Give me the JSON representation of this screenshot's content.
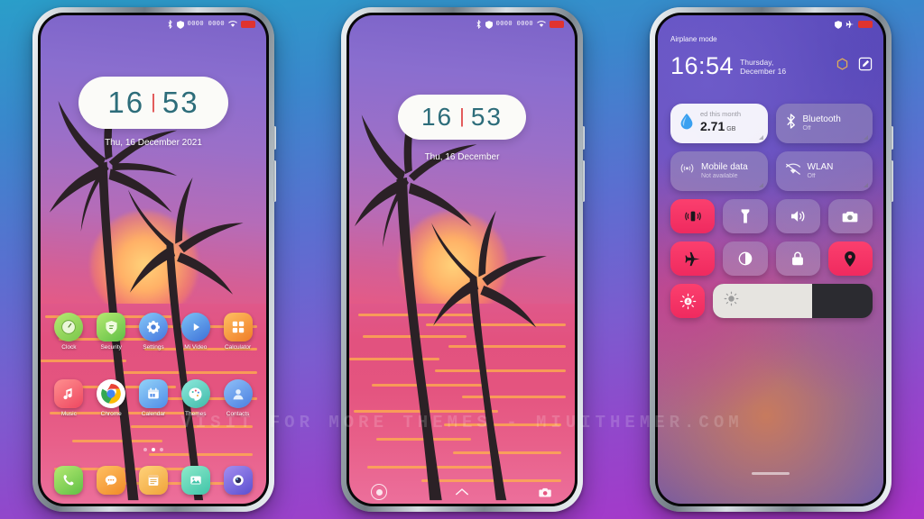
{
  "background": {
    "top_color": "#2a9ec9",
    "bottom_color": "#ab34c9"
  },
  "watermark": {
    "text": "VISIT FOR MORE THEMES - MIUITHEMER.COM"
  },
  "phone1": {
    "label": "lock-and-home-screen",
    "status_bar": {
      "bluetooth": "bluetooth-icon",
      "shield": "shield-icon",
      "signal": "0000 0000",
      "wifi": "wifi-icon",
      "battery": "battery-icon",
      "battery_color": "#e0332f"
    },
    "clock": {
      "hours": "16",
      "separator": "|",
      "minutes": "53"
    },
    "date": "Thu, 16 December 2021",
    "apps_row1": [
      {
        "label": "Clock",
        "icon": "clock-icon",
        "color1": "#a8e063",
        "color2": "#7ec850",
        "round": true
      },
      {
        "label": "Security",
        "icon": "shield-icon",
        "color1": "#a8e063",
        "color2": "#62c24a",
        "round": false
      },
      {
        "label": "Settings",
        "icon": "gear-icon",
        "color1": "#7fc4f5",
        "color2": "#4a7fe0",
        "round": true
      },
      {
        "label": "Mi Video",
        "icon": "play-icon",
        "color1": "#6fb9f2",
        "color2": "#3d6fd8",
        "round": true
      },
      {
        "label": "Calculator",
        "icon": "calculator-icon",
        "color1": "#ffb347",
        "color2": "#f07c2a",
        "round": false
      }
    ],
    "apps_row2": [
      {
        "label": "Music",
        "icon": "music-note-icon",
        "color1": "#ff7b7b",
        "color2": "#ef4a5e",
        "round": false
      },
      {
        "label": "Chrome",
        "icon": "chrome-icon",
        "color1": "#ffffff",
        "color2": "#f2f2f2",
        "round": true
      },
      {
        "label": "Calendar",
        "icon": "calendar-icon",
        "color1": "#8fd0f7",
        "color2": "#4f8ce8",
        "round": false
      },
      {
        "label": "Themes",
        "icon": "palette-icon",
        "color1": "#7fe3d8",
        "color2": "#3fb9a8",
        "round": true
      },
      {
        "label": "Contacts",
        "icon": "person-icon",
        "color1": "#7fb6f5",
        "color2": "#4a7fe0",
        "round": true
      }
    ],
    "dock": [
      {
        "label": "Phone",
        "icon": "phone-icon",
        "color1": "#a8e063",
        "color2": "#62c24a",
        "round": false
      },
      {
        "label": "Messages",
        "icon": "message-icon",
        "color1": "#ffb347",
        "color2": "#f28c28",
        "round": false
      },
      {
        "label": "Notes",
        "icon": "notes-icon",
        "color1": "#ffcc66",
        "color2": "#f0a43a",
        "round": false
      },
      {
        "label": "Gallery",
        "icon": "gallery-icon",
        "color1": "#7fe3c0",
        "color2": "#3fc4a8",
        "round": false
      },
      {
        "label": "Camera",
        "icon": "camera-icon",
        "color1": "#9a7fe8",
        "color2": "#5a4fd0",
        "round": false
      }
    ],
    "page_dots": {
      "count": 3,
      "active_index": 1
    }
  },
  "phone2": {
    "label": "lock-screen",
    "status_bar": {
      "bluetooth": "bluetooth-icon",
      "shield": "shield-icon",
      "signal": "0000 0000",
      "wifi": "wifi-icon",
      "battery": "battery-icon"
    },
    "clock": {
      "hours": "16",
      "separator": "|",
      "minutes": "53"
    },
    "date": "Thu, 16 December",
    "nav": {
      "left_icon": "record-circle-icon",
      "center_icon": "chevron-up-icon",
      "right_icon": "camera-icon"
    }
  },
  "phone3": {
    "label": "control-center",
    "status_bar": {
      "shield": "shield-icon",
      "airplane": "airplane-icon",
      "battery": "battery-icon"
    },
    "airplane_label": "Airplane mode",
    "time": "16:54",
    "date": "Thursday, December 16",
    "actions": [
      {
        "name": "settings-gear-icon"
      },
      {
        "name": "edit-icon"
      }
    ],
    "tiles_wide": [
      {
        "name": "data-usage-tile",
        "icon": "water-drop-icon",
        "title": "ed this month",
        "value": "2.71",
        "unit": "GB",
        "style": "light",
        "state": "on"
      },
      {
        "name": "bluetooth-tile",
        "icon": "bluetooth-icon",
        "title": "Bluetooth",
        "subtitle": "Off",
        "style": "dim",
        "state": "off"
      },
      {
        "name": "mobile-data-tile",
        "icon": "cell-tower-icon",
        "title": "Mobile data",
        "subtitle": "Not available",
        "style": "dim",
        "state": "off"
      },
      {
        "name": "wlan-tile",
        "icon": "wifi-off-icon",
        "title": "WLAN",
        "subtitle": "Off",
        "style": "dim2",
        "state": "off"
      }
    ],
    "toggles": [
      {
        "name": "vibrate-toggle",
        "icon": "vibrate-icon",
        "state": "on"
      },
      {
        "name": "flashlight-toggle",
        "icon": "flashlight-icon",
        "state": "off"
      },
      {
        "name": "volume-toggle",
        "icon": "speaker-icon",
        "state": "off"
      },
      {
        "name": "screenshot-toggle",
        "icon": "camera-icon",
        "state": "off"
      },
      {
        "name": "airplane-toggle",
        "icon": "airplane-icon",
        "state": "on"
      },
      {
        "name": "dark-mode-toggle",
        "icon": "contrast-icon",
        "state": "off"
      },
      {
        "name": "lock-toggle",
        "icon": "lock-icon",
        "state": "off"
      },
      {
        "name": "location-toggle",
        "icon": "location-pin-icon",
        "state": "on"
      }
    ],
    "brightness": {
      "auto_icon": "auto-brightness-icon",
      "slider_icon": "brightness-sun-icon",
      "percent": 62
    },
    "accent_on_color": "#f43163",
    "accent_off_color": "rgba(176,168,196,0.40)"
  }
}
